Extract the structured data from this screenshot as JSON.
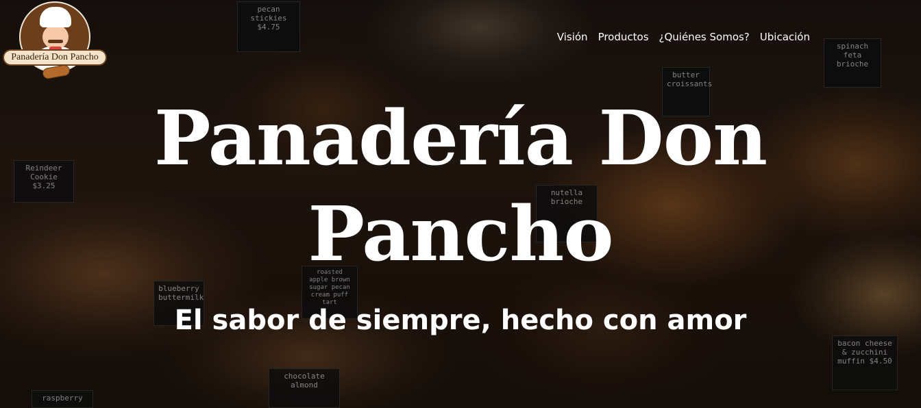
{
  "brand": {
    "logo_text": "Panadería Don Pancho"
  },
  "nav": {
    "items": [
      {
        "label": "Visión"
      },
      {
        "label": "Productos"
      },
      {
        "label": "¿Quiénes Somos?"
      },
      {
        "label": "Ubicación"
      }
    ]
  },
  "hero": {
    "title_line1": "Panadería Don",
    "title_line2": "Pancho",
    "subtitle": "El sabor de siempre, hecho con amor",
    "photo_tags": [
      "pecan stickies $4.75",
      "butter croissants",
      "spinach feta brioche",
      "Reindeer Cookie $3.25",
      "nutella brioche",
      "blueberry buttermilk",
      "roasted apple brown sugar pecan cream puff tart",
      "chocolate almond",
      "bacon cheese & zucchini muffin $4.50",
      "raspberry"
    ]
  },
  "colors": {
    "text": "#ffffff",
    "logo_brown": "#6b3f1c",
    "logo_cream": "#f3e3c8"
  }
}
